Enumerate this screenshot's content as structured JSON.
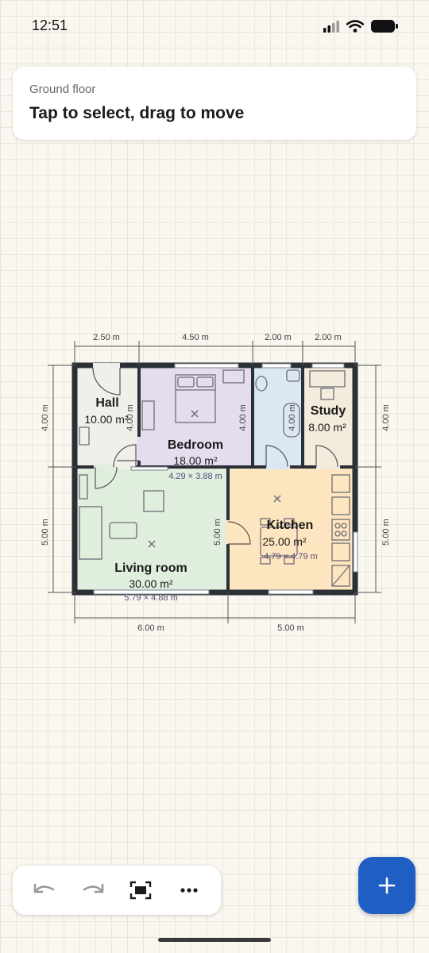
{
  "status": {
    "time": "12:51"
  },
  "header": {
    "floor": "Ground floor",
    "hint": "Tap to select, drag to move"
  },
  "plan": {
    "dims_top": [
      "2.50 m",
      "4.50 m",
      "2.00 m",
      "2.00 m"
    ],
    "dims_bottom": [
      "6.00 m",
      "5.00 m"
    ],
    "dims_left": [
      "4.00 m",
      "5.00 m"
    ],
    "dims_right": [
      "4.00 m",
      "5.00 m"
    ],
    "rooms": {
      "hall": {
        "name": "Hall",
        "area": "10.00 m²",
        "inner_dim": "4.00 m"
      },
      "bedroom": {
        "name": "Bedroom",
        "area": "18.00 m²",
        "size": "4.29 × 3.88 m",
        "inner_dim": "4.00 m"
      },
      "bathroom": {
        "inner_dim": "4.00 m"
      },
      "study": {
        "name": "Study",
        "area": "8.00 m²"
      },
      "living": {
        "name": "Living room",
        "area": "30.00 m²",
        "size": "5.79 × 4.88 m",
        "inner_dim": "5.00 m"
      },
      "kitchen": {
        "name": "Kitchen",
        "area": "25.00 m²",
        "size": "4.79 × 4.79 m"
      }
    }
  },
  "toolbar": {
    "undo": "undo-icon",
    "redo": "redo-icon",
    "fit": "fit-screen-icon",
    "more": "more-icon"
  },
  "fab": {
    "icon": "plus-icon"
  }
}
